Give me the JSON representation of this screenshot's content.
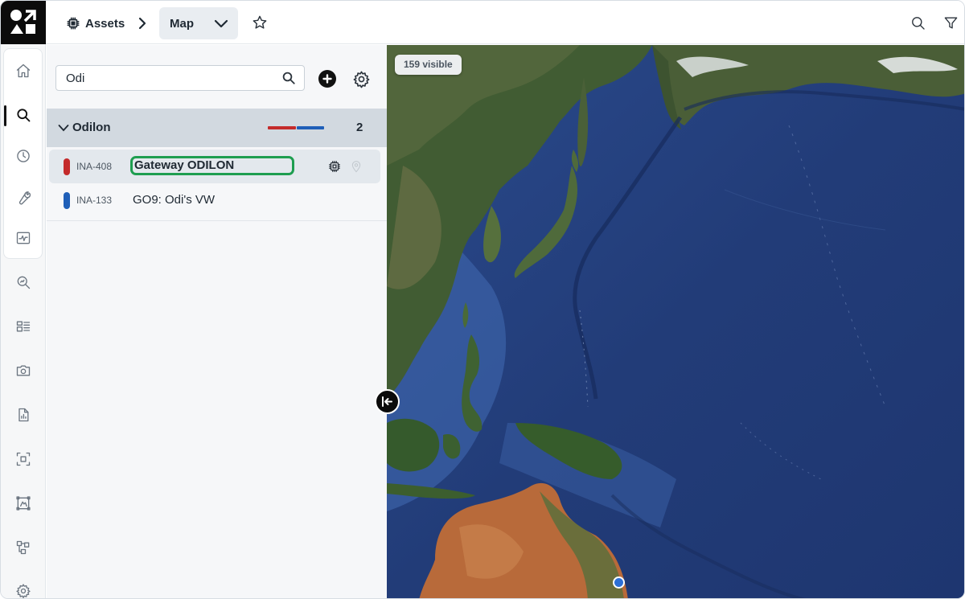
{
  "header": {
    "section_label": "Assets",
    "view_label": "Map",
    "icons": [
      "assets-chip-icon",
      "chevron-right-icon",
      "chevron-down-icon",
      "star-icon",
      "search-icon",
      "filter-icon"
    ]
  },
  "sidebar": {
    "items": [
      {
        "icon": "home-icon",
        "active": false
      },
      {
        "icon": "search-icon",
        "active": true
      },
      {
        "icon": "clock-icon",
        "active": false
      },
      {
        "icon": "wrench-icon",
        "active": false
      },
      {
        "icon": "activity-icon",
        "active": false
      },
      {
        "icon": "zoom-search-icon",
        "active": false
      },
      {
        "icon": "dashboard-icon",
        "active": false
      },
      {
        "icon": "camera-icon",
        "active": false
      },
      {
        "icon": "report-icon",
        "active": false
      },
      {
        "icon": "select-area-icon",
        "active": false
      },
      {
        "icon": "frame-icon",
        "active": false
      },
      {
        "icon": "hierarchy-icon",
        "active": false
      },
      {
        "icon": "settings-icon",
        "active": false
      }
    ]
  },
  "list": {
    "search_value": "Odi",
    "group": {
      "name": "Odilon",
      "count": "2",
      "status_colors": [
        "#c42b2b",
        "#1f5fb8"
      ]
    },
    "items": [
      {
        "id": "INA-408",
        "name": "Gateway ODILON",
        "status_color": "#c42b2b",
        "selected": true,
        "icons": [
          "chip-icon",
          "location-pin-icon"
        ]
      },
      {
        "id": "INA-133",
        "name": "GO9: Odi's VW",
        "status_color": "#1f5fb8",
        "selected": false,
        "icons": []
      }
    ]
  },
  "map": {
    "visible_count_label": "159 visible",
    "colors": {
      "ocean": "#243f7c",
      "land_green": "#3c5a2c",
      "desert": "#b86a3a",
      "marker": "#2d6fd6"
    }
  }
}
